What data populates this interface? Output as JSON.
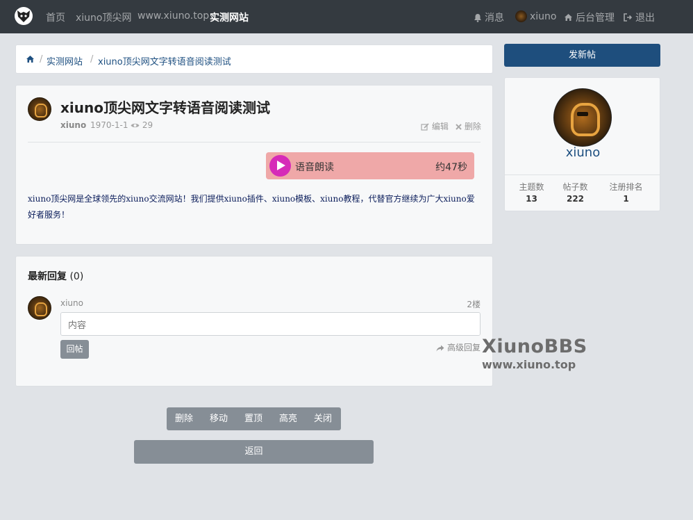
{
  "navbar": {
    "items": [
      "首页",
      "xiuno顶尖网",
      "www.xiuno.top",
      "实测网站"
    ],
    "messages": "消息",
    "username": "xiuno",
    "admin": "后台管理",
    "logout": "退出"
  },
  "breadcrumb": {
    "items": [
      "实测网站",
      "xiuno顶尖网文字转语音阅读测试"
    ]
  },
  "post": {
    "title": "xiuno顶尖网文字转语音阅读测试",
    "author": "xiuno",
    "date": "1970-1-1",
    "views": "29",
    "edit": "编辑",
    "delete": "删除",
    "player_label": "语音朗读",
    "player_duration": "约47秒",
    "body": "xiuno顶尖网是全球领先的xiuno交流网站！我们提供xiuno插件、xiuno模板、xiuno教程，代替官方继续为广大xiuno爱好者服务！"
  },
  "replies": {
    "heading": "最新回复",
    "count": "(0)",
    "user": "xiuno",
    "floor": "2楼",
    "placeholder": "内容",
    "reply_button": "回帖",
    "advanced_reply": "高级回复"
  },
  "watermark": {
    "title": "XiunoBBS",
    "url": "www.xiuno.top"
  },
  "admin_actions": [
    "删除",
    "移动",
    "置顶",
    "高亮",
    "关闭"
  ],
  "back_button": "返回",
  "sidebar": {
    "new_post": "发新帖",
    "name": "xiuno",
    "stats": [
      {
        "label": "主题数",
        "value": "13"
      },
      {
        "label": "帖子数",
        "value": "222"
      },
      {
        "label": "注册排名",
        "value": "1"
      }
    ]
  },
  "colors": {
    "navbar": "#343a40",
    "primary": "#1e4e7d",
    "player_bg": "#efa8a8",
    "play_button": "#d62ab8",
    "secondary_button": "#868e96"
  },
  "icons": [
    "logo-icon",
    "bell-icon",
    "home-icon",
    "signout-icon",
    "edit-icon",
    "times-icon",
    "eye-icon",
    "play-icon",
    "share-icon"
  ]
}
